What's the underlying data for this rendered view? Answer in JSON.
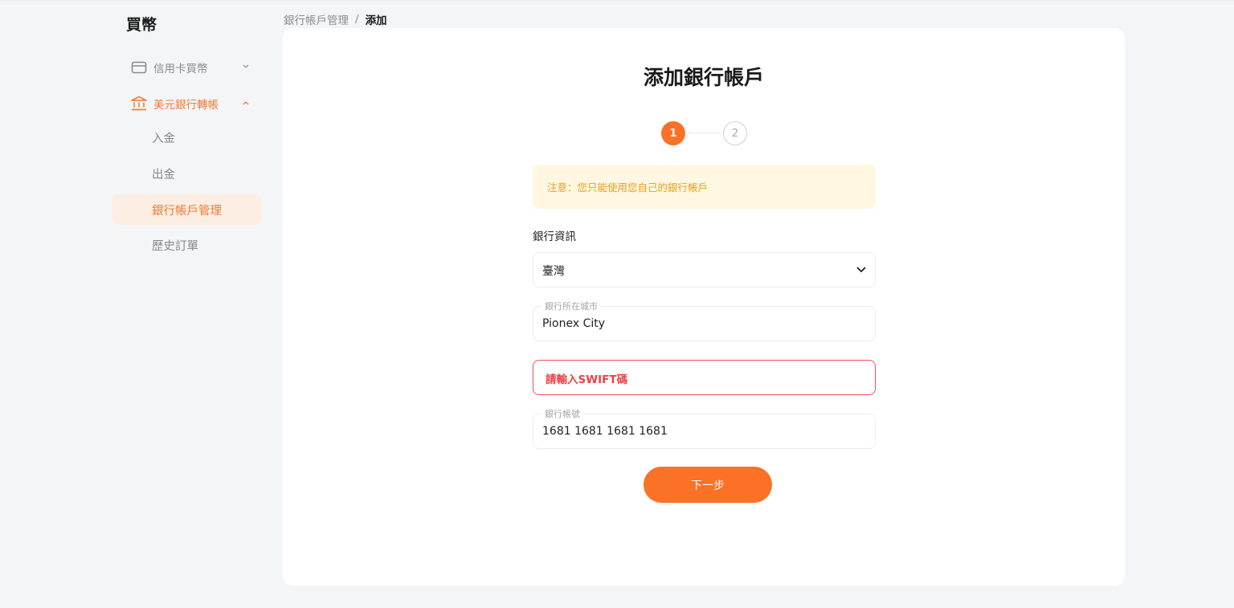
{
  "sidebar": {
    "title": "買幣",
    "groups": [
      {
        "label": "信用卡買幣",
        "icon": "wallet-icon",
        "expanded": false
      },
      {
        "label": "美元銀行轉帳",
        "icon": "bank-icon",
        "expanded": true
      }
    ],
    "items": [
      {
        "label": "入金"
      },
      {
        "label": "出金"
      },
      {
        "label": "銀行帳戶管理",
        "selected": true
      },
      {
        "label": "歷史訂單"
      }
    ]
  },
  "breadcrumb": {
    "parent": "銀行帳戶管理",
    "separator": "/",
    "current": "添加"
  },
  "main": {
    "title": "添加銀行帳戶",
    "steps": [
      "1",
      "2"
    ],
    "current_step": 1,
    "notice": "注意：您只能使用您自己的銀行帳戶",
    "bank_info_label": "銀行資訊",
    "country_select": {
      "value": "臺灣",
      "icon": "chevron-down-icon"
    },
    "city_field": {
      "label": "銀行所在城市",
      "value": "Pionex City"
    },
    "swift_field": {
      "placeholder": "請輸入SWIFT碼",
      "error": true
    },
    "account_field": {
      "label": "銀行帳號",
      "value": "1681 1681 1681 1681"
    },
    "next_button": "下一步"
  },
  "colors": {
    "accent": "#fb7126",
    "accent_text": "#f07a3a",
    "selected_bg": "#fdeee3",
    "notice_bg": "#fff7e1",
    "notice_text": "#e3a21f",
    "error": "#ea4247",
    "page_bg": "#f4f5f7",
    "card_bg": "#ffffff"
  }
}
